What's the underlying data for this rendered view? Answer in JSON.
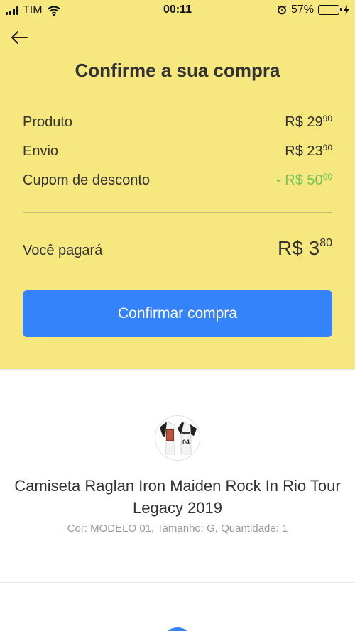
{
  "status_bar": {
    "carrier": "TIM",
    "time": "00:11",
    "battery": "57%",
    "battery_level": 0.57
  },
  "header": {
    "title": "Confirme a sua compra"
  },
  "summary": {
    "product": {
      "label": "Produto",
      "amount": "R$ 29",
      "cents": "90"
    },
    "shipping": {
      "label": "Envio",
      "amount": "R$ 23",
      "cents": "90"
    },
    "coupon": {
      "label": "Cupom de desconto",
      "amount": "- R$ 50",
      "cents": "00"
    }
  },
  "total": {
    "label": "Você pagará",
    "amount": "R$ 3",
    "cents": "80"
  },
  "confirm_button": {
    "label": "Confirmar compra"
  },
  "item": {
    "name": "Camiseta Raglan Iron Maiden Rock In Rio Tour Legacy  2019",
    "details": "Cor: MODELO 01, Tamanho: G, Quantidade: 1",
    "shirt_number": "04"
  },
  "colors": {
    "background": "#f7e77f",
    "accent": "#3483fa",
    "discount": "#6cc55d"
  }
}
